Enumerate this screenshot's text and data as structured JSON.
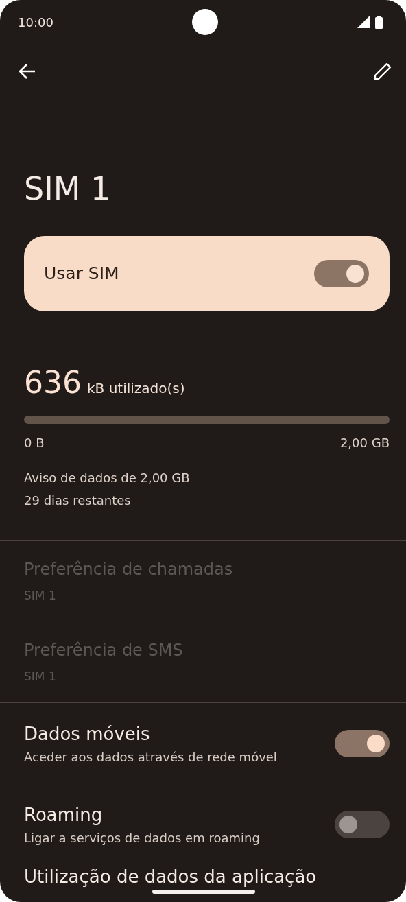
{
  "status_bar": {
    "time": "10:00"
  },
  "title": "SIM 1",
  "use_sim": {
    "label": "Usar SIM",
    "on": true
  },
  "usage": {
    "amount": "636",
    "unit": "kB utilizado(s)",
    "level": 0,
    "min_label": "0 B",
    "max_label": "2,00 GB",
    "warning": "Aviso de dados de 2,00 GB",
    "days_left": "29 dias restantes"
  },
  "preferences": [
    {
      "title": "Preferência de chamadas",
      "value": "SIM 1",
      "disabled": true
    },
    {
      "title": "Preferência de SMS",
      "value": "SIM 1",
      "disabled": true
    }
  ],
  "toggles": [
    {
      "title": "Dados móveis",
      "summary": "Aceder aos dados através de rede móvel",
      "on": true
    },
    {
      "title": "Roaming",
      "summary": "Ligar a serviços de dados em roaming",
      "on": false
    }
  ],
  "last_item": {
    "title": "Utilização de dados da aplicação"
  }
}
